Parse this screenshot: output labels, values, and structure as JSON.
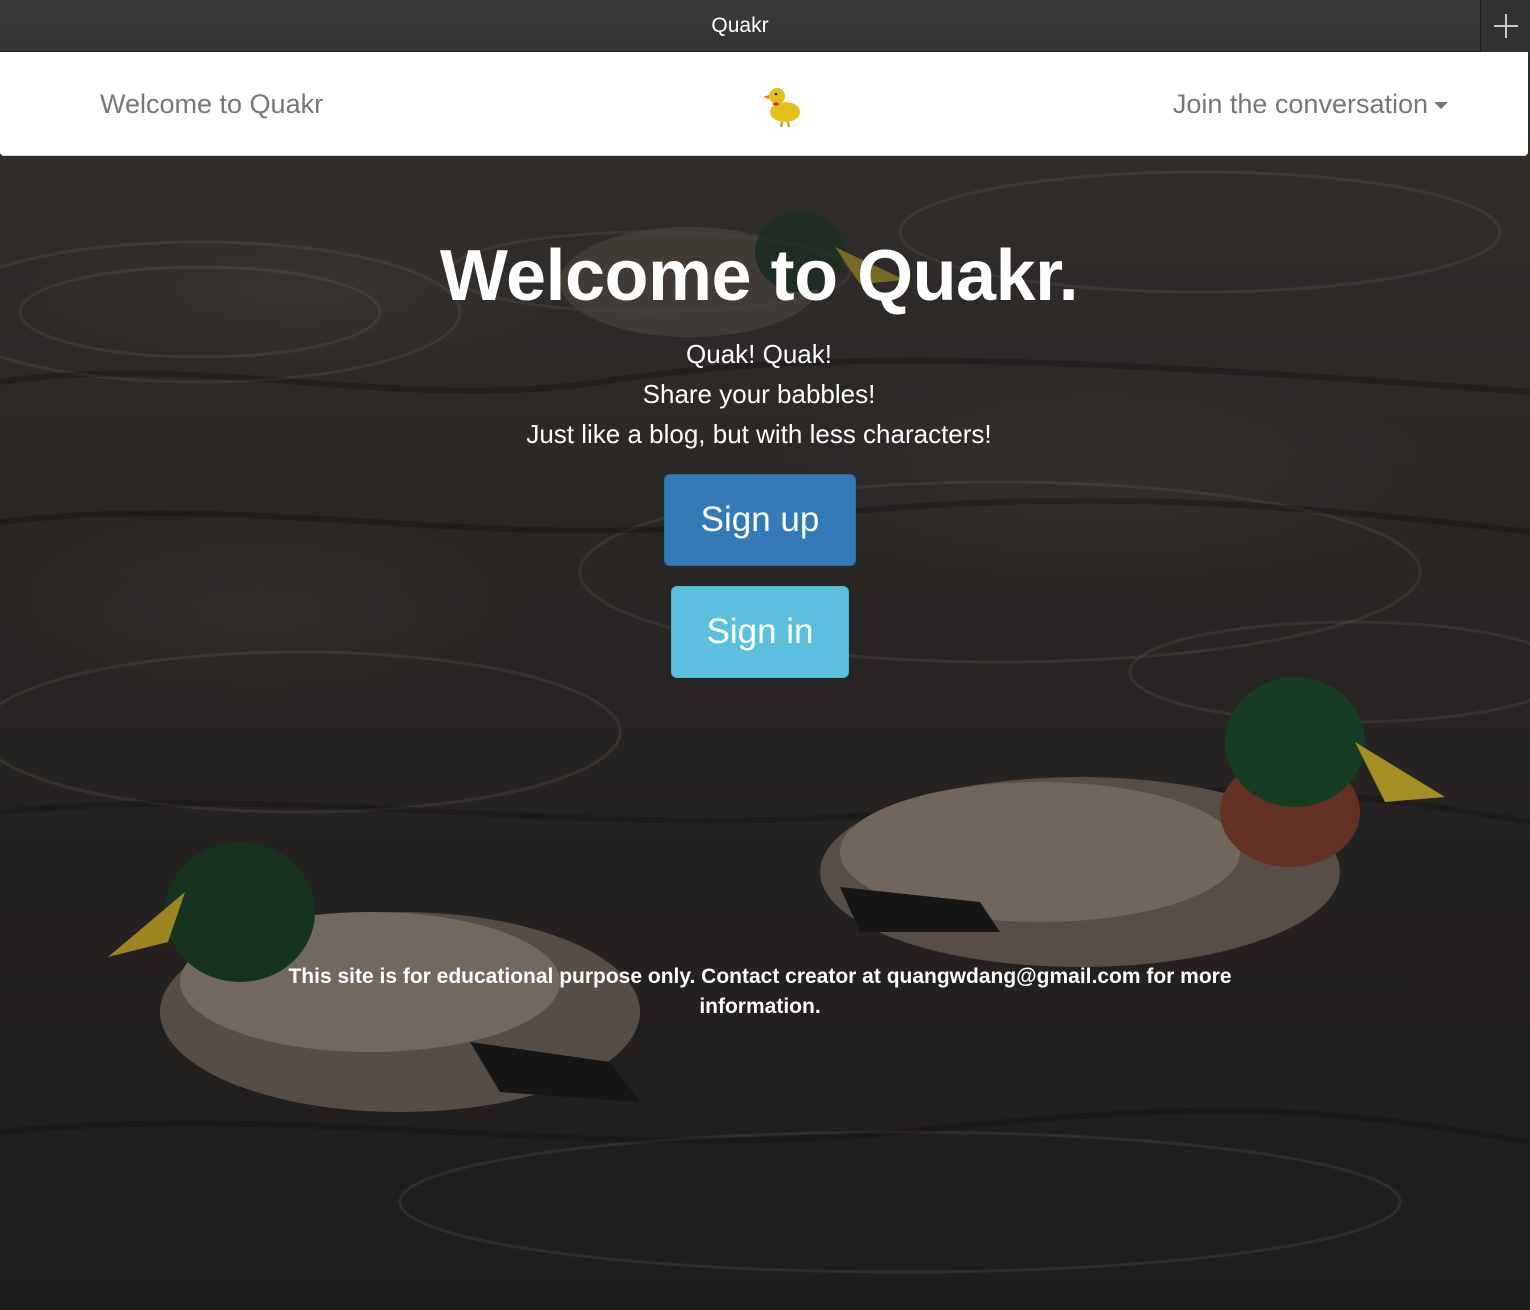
{
  "browser": {
    "tab_title": "Quakr"
  },
  "navbar": {
    "brand": "Welcome to Quakr",
    "logo_icon": "duck-icon",
    "dropdown_label": "Join the conversation"
  },
  "hero": {
    "title": "Welcome to Quakr.",
    "lines": [
      "Quak! Quak!",
      "Share your babbles!",
      "Just like a blog, but with less characters!"
    ],
    "signup_label": "Sign up",
    "signin_label": "Sign in"
  },
  "footer": {
    "text": "This site is for educational purpose only. Contact creator at quangwdang@gmail.com for more information."
  },
  "colors": {
    "primary": "#337ab7",
    "info": "#5bc0de",
    "nav_text": "#777777"
  }
}
